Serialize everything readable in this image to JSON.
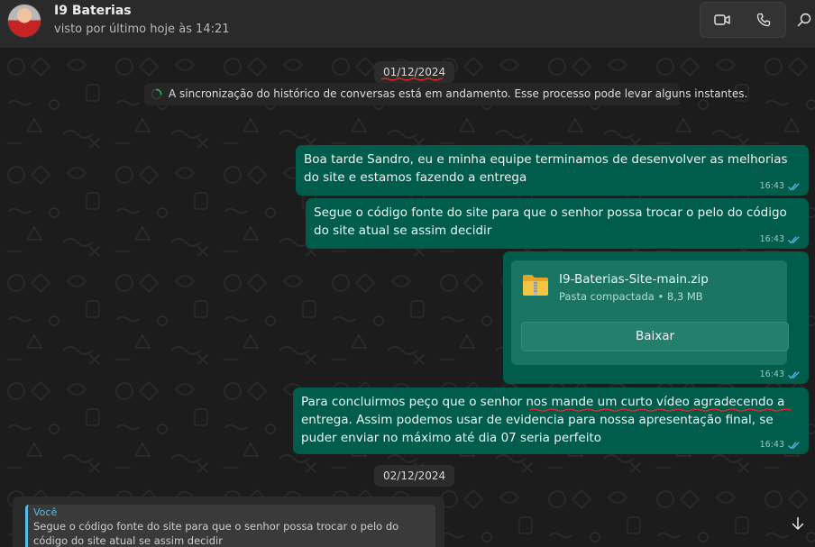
{
  "header": {
    "contact_name": "I9 Baterias",
    "status": "visto por último hoje às 14:21",
    "icons": {
      "video": "video-call-icon",
      "phone": "voice-call-icon",
      "search": "search-icon"
    }
  },
  "chat": {
    "date_chips": [
      "01/12/2024",
      "02/12/2024"
    ],
    "sync_banner": "A sincronização do histórico de conversas está em andamento. Esse processo pode levar alguns instantes.",
    "messages": [
      {
        "text": "Boa tarde Sandro, eu e minha equipe terminamos de desenvolver as melhorias do site e estamos fazendo a entrega",
        "time": "16:43"
      },
      {
        "text": "Segue o código fonte do site para que o senhor possa trocar o pelo do código do site atual se assim decidir",
        "time": "16:43"
      },
      {
        "file": {
          "name": "I9-Baterias-Site-main.zip",
          "info": "Pasta compactada • 8,3 MB",
          "download_label": "Baixar"
        },
        "time": "16:43"
      },
      {
        "text": "Para concluirmos peço que o senhor nos mande um curto vídeo agradecendo a entrega. Assim podemos usar de evidencia para nossa apresentação final, se puder enviar no máximo até dia 07 seria perfeito",
        "time": "16:43"
      }
    ],
    "quoted_reply": {
      "author": "Você",
      "text": "Segue o código fonte do site para que o senhor possa trocar o pelo do código do site atual se assim decidir"
    }
  },
  "colors": {
    "outgoing_bubble": "#005c4b",
    "file_card": "#197461",
    "quote_accent": "#53bdeb",
    "tick_read": "#53bdeb",
    "annotation_underline": "#e02424"
  }
}
